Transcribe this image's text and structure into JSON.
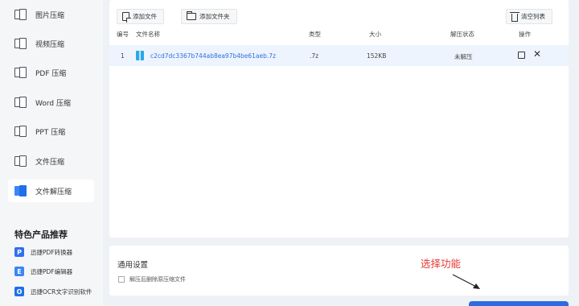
{
  "sidebar": {
    "items": [
      {
        "label": "图片压缩"
      },
      {
        "label": "视频压缩"
      },
      {
        "label": "PDF 压缩"
      },
      {
        "label": "Word 压缩"
      },
      {
        "label": "PPT 压缩"
      },
      {
        "label": "文件压缩"
      },
      {
        "label": "文件解压缩",
        "active": true
      }
    ],
    "section_title": "特色产品推荐",
    "products": [
      {
        "label": "迅捷PDF转换器",
        "icon": "pdf-converter-icon",
        "color": "#2f6ff0",
        "glyph": "P"
      },
      {
        "label": "迅捷PDF编辑器",
        "icon": "pdf-editor-icon",
        "color": "#3b86f5",
        "glyph": "E"
      },
      {
        "label": "迅捷OCR文字识别软件",
        "icon": "ocr-icon",
        "color": "#1f6fe8",
        "glyph": "O"
      }
    ]
  },
  "toolbar": {
    "add_file": "添加文件",
    "add_folder": "添加文件夹",
    "clear_list": "清空列表"
  },
  "table": {
    "headers": {
      "index": "编号",
      "name": "文件名称",
      "type": "类型",
      "size": "大小",
      "status": "解压状态",
      "action": "操作"
    },
    "rows": [
      {
        "index": "1",
        "name": "c2cd7dc3367b744ab8ea97b4be61aeb.7z",
        "type": ".7z",
        "size": "152KB",
        "status": "未解压"
      }
    ]
  },
  "settings": {
    "title": "通用设置",
    "checkbox_label": "解压后删除原压缩文件",
    "checkbox_checked": false
  },
  "annotation": "选择功能",
  "colors": {
    "accent": "#2d6be0",
    "annotation": "#e53935",
    "row_highlight": "#eef4fd"
  }
}
